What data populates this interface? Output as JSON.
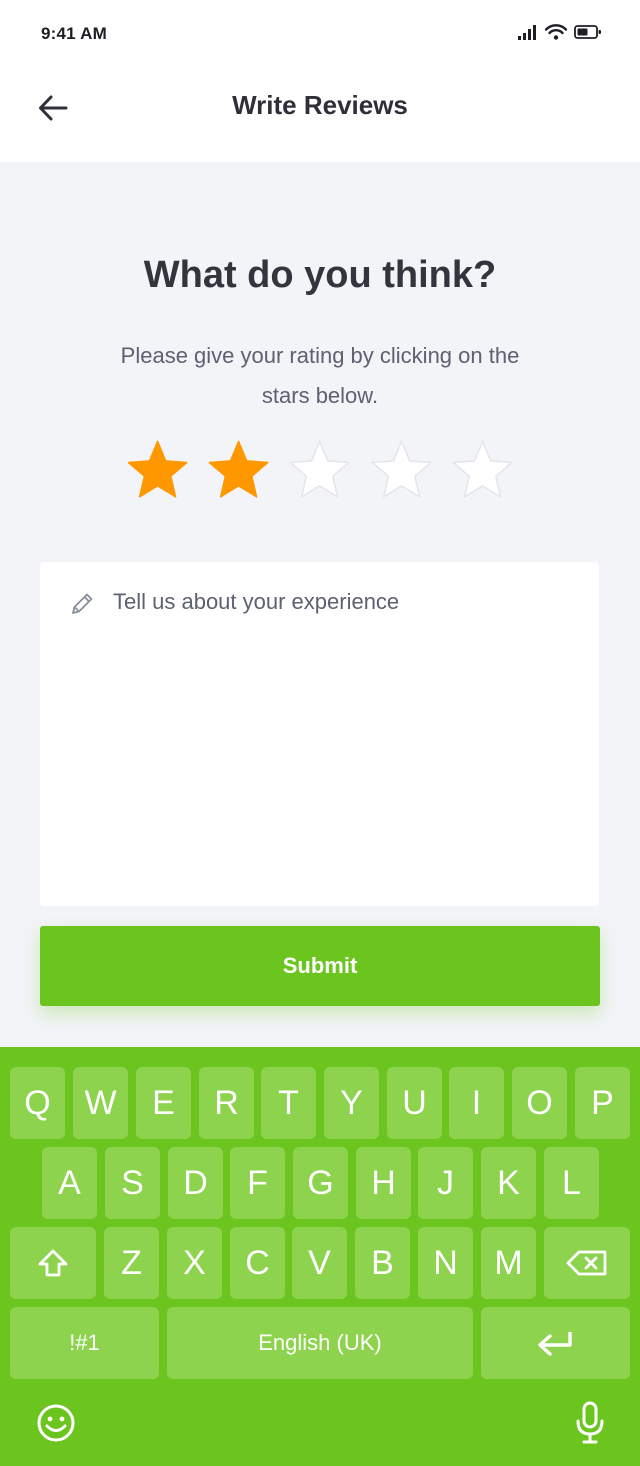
{
  "status_bar": {
    "time": "9:41 AM",
    "icons": [
      "signal-icon",
      "wifi-icon",
      "battery-icon"
    ]
  },
  "header": {
    "title": "Write Reviews",
    "back_icon": "arrow-left-icon"
  },
  "main": {
    "question": "What do you think?",
    "instruction": "Please give your rating by clicking on the stars below.",
    "rating": {
      "value": 2,
      "max": 5,
      "filled_color": "#ff9800",
      "empty_color": "#ffffff"
    },
    "review": {
      "placeholder": "Tell us about your experience",
      "icon": "pencil-icon"
    },
    "submit_label": "Submit"
  },
  "keyboard": {
    "row1": [
      "Q",
      "W",
      "E",
      "R",
      "T",
      "Y",
      "U",
      "I",
      "O",
      "P"
    ],
    "row2": [
      "A",
      "S",
      "D",
      "F",
      "G",
      "H",
      "J",
      "K",
      "L"
    ],
    "row3": [
      "Z",
      "X",
      "C",
      "V",
      "B",
      "N",
      "M"
    ],
    "symbols_label": "!#1",
    "space_label": "English (UK)",
    "icons": [
      "shift-icon",
      "backspace-icon",
      "enter-icon",
      "emoji-icon",
      "microphone-icon"
    ],
    "accent_color": "#6cc41e"
  }
}
